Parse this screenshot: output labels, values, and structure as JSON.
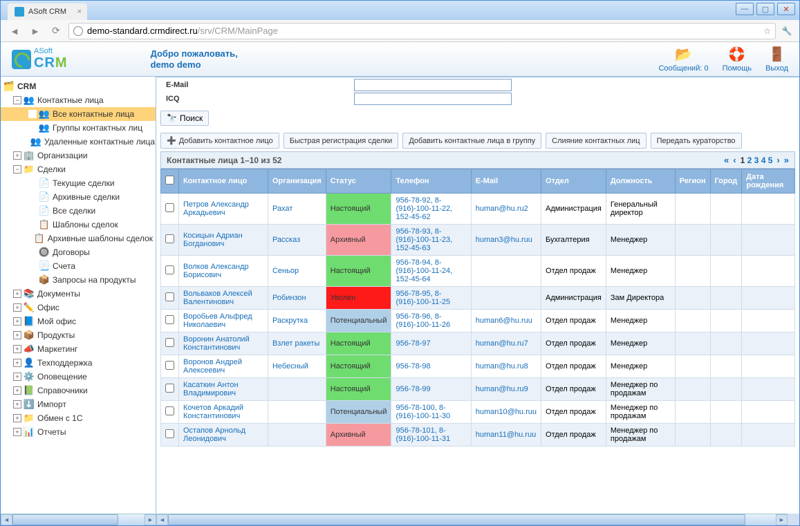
{
  "browser": {
    "tab_title": "ASoft CRM",
    "url_host": "demo-standard.crmdirect.ru",
    "url_path": "/srv/CRM/MainPage"
  },
  "header": {
    "logo_brand_top": "ASoft",
    "logo_brand": "CRM",
    "welcome_line1": "Добро пожаловать,",
    "welcome_line2": "demo demo",
    "messages_label": "Сообщений: 0",
    "help_label": "Помощь",
    "exit_label": "Выход"
  },
  "sidebar": {
    "root": "CRM",
    "items": [
      {
        "label": "Контактные лица",
        "icon": "👥",
        "expanded": true,
        "children": [
          {
            "label": "Все контактные лица",
            "icon": "👥",
            "selected": true
          },
          {
            "label": "Группы контактных лиц",
            "icon": "👥"
          },
          {
            "label": "Удаленные контактные лица",
            "icon": "👥"
          }
        ]
      },
      {
        "label": "Организации",
        "icon": "🏢"
      },
      {
        "label": "Сделки",
        "icon": "📁",
        "expanded": true,
        "children": [
          {
            "label": "Текущие сделки",
            "icon": "📄"
          },
          {
            "label": "Архивные сделки",
            "icon": "📄"
          },
          {
            "label": "Все сделки",
            "icon": "📄"
          },
          {
            "label": "Шаблоны сделок",
            "icon": "📋"
          },
          {
            "label": "Архивные шаблоны сделок",
            "icon": "📋"
          },
          {
            "label": "Договоры",
            "icon": "🔘"
          },
          {
            "label": "Счета",
            "icon": "📃"
          },
          {
            "label": "Запросы на продукты",
            "icon": "📦"
          }
        ]
      },
      {
        "label": "Документы",
        "icon": "📚"
      },
      {
        "label": "Офис",
        "icon": "✏️"
      },
      {
        "label": "Мой офис",
        "icon": "📘"
      },
      {
        "label": "Продукты",
        "icon": "📦"
      },
      {
        "label": "Маркетинг",
        "icon": "📣"
      },
      {
        "label": "Техподдержка",
        "icon": "👤"
      },
      {
        "label": "Оповещение",
        "icon": "⚙️"
      },
      {
        "label": "Справочники",
        "icon": "📗"
      },
      {
        "label": "Импорт",
        "icon": "⬇️"
      },
      {
        "label": "Обмен с 1С",
        "icon": "📁"
      },
      {
        "label": "Отчеты",
        "icon": "📊"
      }
    ]
  },
  "filters": {
    "email_label": "E-Mail",
    "icq_label": "ICQ"
  },
  "search_label": "Поиск",
  "actions": {
    "add_contact": "Добавить контактное лицо",
    "quick_deal": "Быстрая регистрация сделки",
    "add_to_group": "Добавить контактные лица в группу",
    "merge": "Слияние контактных лиц",
    "transfer": "Передать кураторство"
  },
  "table": {
    "caption": "Контактные лица 1–10 из 52",
    "pages": [
      "1",
      "2",
      "3",
      "4",
      "5"
    ],
    "current_page": "1",
    "columns": [
      "Контактное лицо",
      "Организация",
      "Статус",
      "Телефон",
      "E-Mail",
      "Отдел",
      "Должность",
      "Регион",
      "Город",
      "Дата рождения"
    ],
    "rows": [
      {
        "name": "Петров Александр Аркадьевич",
        "org": "Рахат",
        "status": "Настоящий",
        "status_cls": "st-green",
        "phone": "956-78-92, 8-(916)-100-11-22, 152-45-62",
        "email": "human@hu.ru2",
        "dept": "Администрация",
        "pos": "Генеральный директор"
      },
      {
        "name": "Косицын Адриан Богданович",
        "org": "Рассказ",
        "status": "Архивный",
        "status_cls": "st-pink",
        "phone": "956-78-93, 8-(916)-100-11-23, 152-45-63",
        "email": "human3@hu.ruu",
        "dept": "Бухгалтерия",
        "pos": "Менеджер"
      },
      {
        "name": "Волков Александр Борисович",
        "org": "Сеньор",
        "status": "Настоящий",
        "status_cls": "st-green",
        "phone": "956-78-94, 8-(916)-100-11-24, 152-45-64",
        "email": "",
        "dept": "Отдел продаж",
        "pos": "Менеджер"
      },
      {
        "name": "Вольваков Алексей Валентинович",
        "org": "Робинзон",
        "status": "Уволен",
        "status_cls": "st-red",
        "phone": "956-78-95, 8-(916)-100-11-25",
        "email": "",
        "dept": "Администрация",
        "pos": "Зам Директора"
      },
      {
        "name": "Воробьев Альфред Николаевич",
        "org": "Раскрутка",
        "status": "Потенциальный",
        "status_cls": "st-blue",
        "phone": "956-78-96, 8-(916)-100-11-26",
        "email": "human6@hu.ruu",
        "dept": "Отдел продаж",
        "pos": "Менеджер"
      },
      {
        "name": "Воронин Анатолий Константинович",
        "org": "Взлет ракеты",
        "status": "Настоящий",
        "status_cls": "st-green",
        "phone": "956-78-97",
        "email": "human@hu.ru7",
        "dept": "Отдел продаж",
        "pos": "Менеджер"
      },
      {
        "name": "Воронов Андрей Алексеевич",
        "org": "Небесный",
        "status": "Настоящий",
        "status_cls": "st-green",
        "phone": "956-78-98",
        "email": "human@hu.ru8",
        "dept": "Отдел продаж",
        "pos": "Менеджер"
      },
      {
        "name": "Касаткин Антон Владимирович",
        "org": "",
        "status": "Настоящий",
        "status_cls": "st-green",
        "phone": "956-78-99",
        "email": "human@hu.ru9",
        "dept": "Отдел продаж",
        "pos": "Менеджер по продажам"
      },
      {
        "name": "Кочетов Аркадий Константинович",
        "org": "",
        "status": "Потенциальный",
        "status_cls": "st-blue",
        "phone": "956-78-100, 8-(916)-100-11-30",
        "email": "human10@hu.ruu",
        "dept": "Отдел продаж",
        "pos": "Менеджер по продажам"
      },
      {
        "name": "Остапов Арнольд Леонидович",
        "org": "",
        "status": "Архивный",
        "status_cls": "st-pink",
        "phone": "956-78-101, 8-(916)-100-11-31",
        "email": "human11@hu.ruu",
        "dept": "Отдел продаж",
        "pos": "Менеджер по продажам"
      }
    ]
  }
}
